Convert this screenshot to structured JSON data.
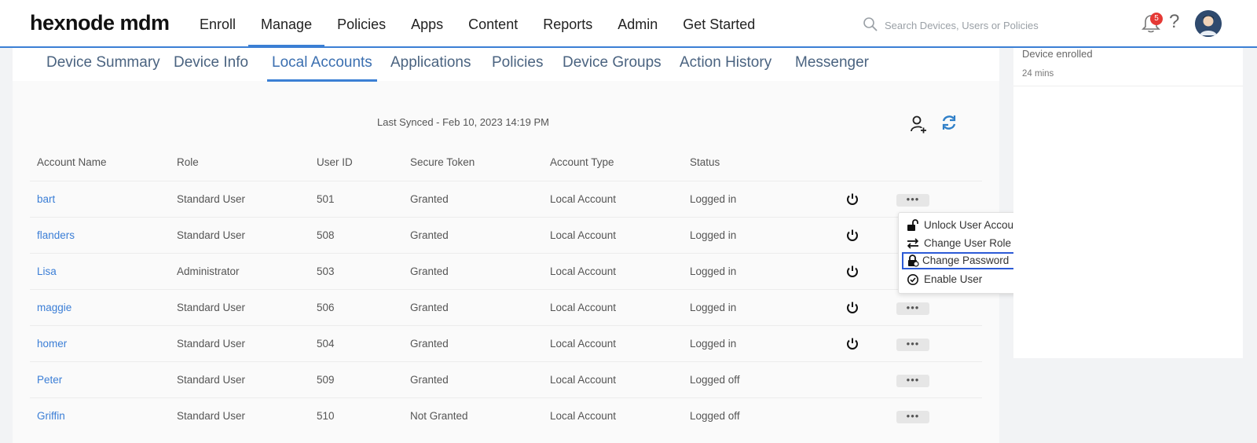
{
  "header": {
    "logo": "hexnode mdm",
    "nav": [
      "Enroll",
      "Manage",
      "Policies",
      "Apps",
      "Content",
      "Reports",
      "Admin",
      "Get Started"
    ],
    "active_nav": "Manage",
    "search_placeholder": "Search Devices, Users or Policies",
    "notification_count": "5",
    "help_label": "?"
  },
  "subtabs": [
    "Device Summary",
    "Device Info",
    "Local Accounts",
    "Applications",
    "Policies",
    "Device Groups",
    "Action History",
    "Messenger"
  ],
  "active_subtab": "Local Accounts",
  "last_synced": "Last Synced - Feb 10, 2023 14:19 PM",
  "table": {
    "headers": [
      "Account Name",
      "Role",
      "User ID",
      "Secure Token",
      "Account Type",
      "Status"
    ],
    "rows": [
      {
        "name": "bart",
        "role": "Standard User",
        "uid": "501",
        "token": "Granted",
        "type": "Local Account",
        "status": "Logged in"
      },
      {
        "name": "flanders",
        "role": "Standard User",
        "uid": "508",
        "token": "Granted",
        "type": "Local Account",
        "status": "Logged in"
      },
      {
        "name": "Lisa",
        "role": "Administrator",
        "uid": "503",
        "token": "Granted",
        "type": "Local Account",
        "status": "Logged in"
      },
      {
        "name": "maggie",
        "role": "Standard User",
        "uid": "506",
        "token": "Granted",
        "type": "Local Account",
        "status": "Logged in"
      },
      {
        "name": "homer",
        "role": "Standard User",
        "uid": "504",
        "token": "Granted",
        "type": "Local Account",
        "status": "Logged in"
      },
      {
        "name": "Peter",
        "role": "Standard User",
        "uid": "509",
        "token": "Granted",
        "type": "Local Account",
        "status": "Logged off"
      },
      {
        "name": "Griffin",
        "role": "Standard User",
        "uid": "510",
        "token": "Not Granted",
        "type": "Local Account",
        "status": "Logged off"
      }
    ],
    "more_label": "•••"
  },
  "menu": {
    "items": [
      {
        "label": "Unlock User Account",
        "icon": "unlock-icon"
      },
      {
        "label": "Change User Role",
        "icon": "swap-icon"
      },
      {
        "label": "Change Password",
        "icon": "lock-key-icon"
      },
      {
        "label": "Enable User",
        "icon": "check-circle-icon"
      }
    ],
    "focused": "Change Password"
  },
  "activity": {
    "event": "Device enrolled",
    "time": "24 mins"
  },
  "colors": {
    "accent": "#3b7fd4",
    "link": "#3b7ed6",
    "badge": "#e53935",
    "focus": "#2d5bd6"
  }
}
